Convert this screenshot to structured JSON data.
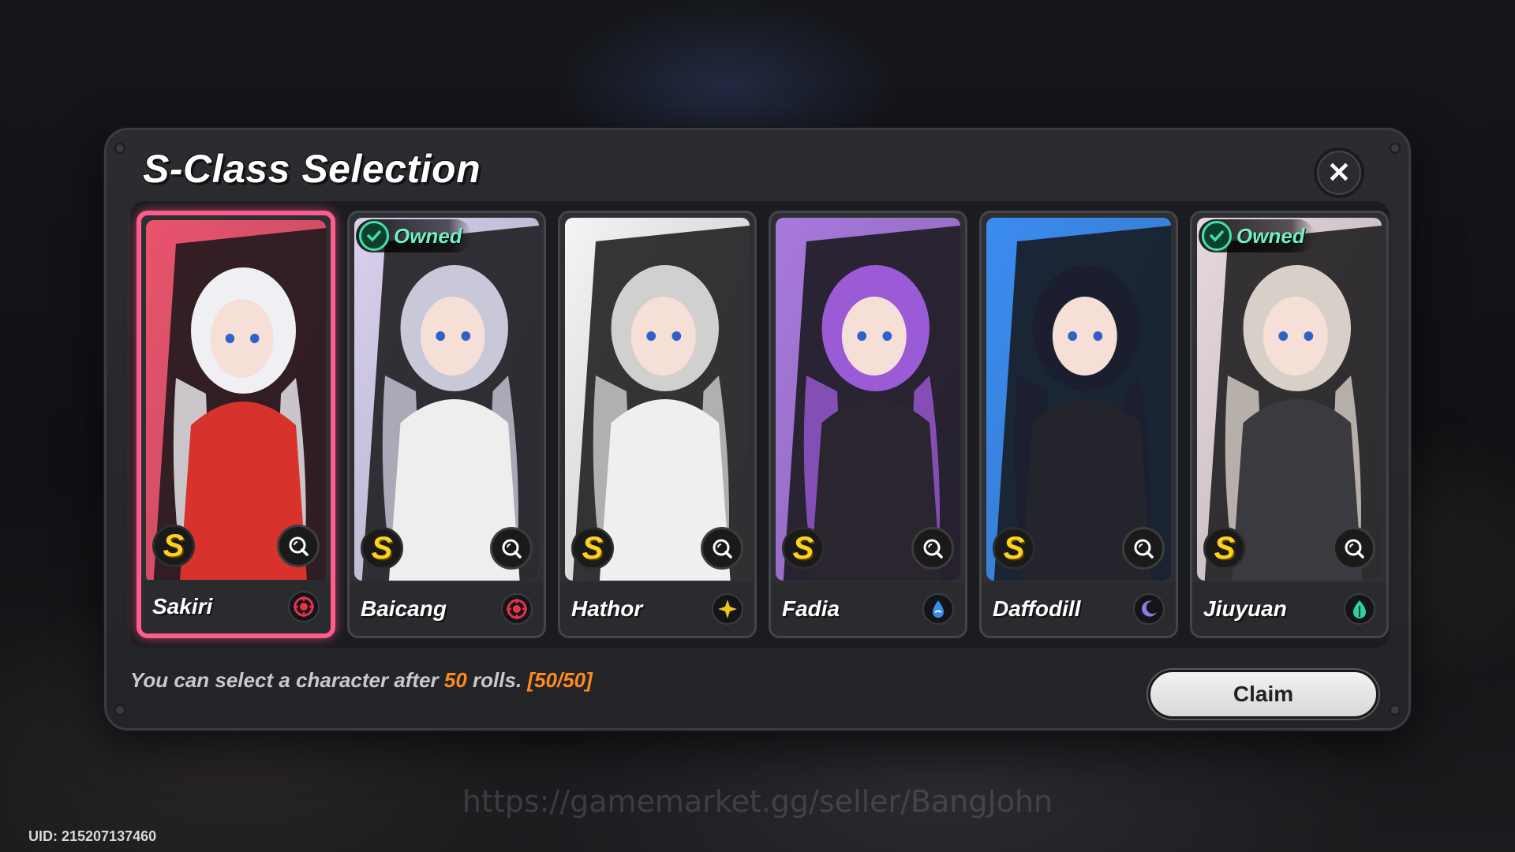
{
  "dialog": {
    "title": "S-Class Selection",
    "close_icon": "close-icon",
    "footer": {
      "prefix": "You can select a character after ",
      "rolls": "50",
      "middle": " rolls. ",
      "progress": "[50/50]"
    },
    "claim_label": "Claim"
  },
  "cards": [
    {
      "name": "Sakiri",
      "owned": false,
      "selected": true,
      "rank": "S",
      "attribute_icon": "target-icon",
      "accent": "#ff5c8c",
      "bg": "#e9536d",
      "hair": "#f0f0f4",
      "outfit": "#d8322c",
      "attr_color": "#e8324a"
    },
    {
      "name": "Baicang",
      "owned": true,
      "selected": false,
      "rank": "S",
      "attribute_icon": "target-icon",
      "accent": "#c9bde6",
      "bg": "#d8d0ee",
      "hair": "#c8c8d8",
      "outfit": "#eeeeee",
      "attr_color": "#e8324a"
    },
    {
      "name": "Hathor",
      "owned": false,
      "selected": false,
      "rank": "S",
      "attribute_icon": "star-icon",
      "accent": "#f2f2f2",
      "bg": "#f4f4f4",
      "hair": "#d0d0d0",
      "outfit": "#efefef",
      "attr_color": "#f2c21e"
    },
    {
      "name": "Fadia",
      "owned": false,
      "selected": false,
      "rank": "S",
      "attribute_icon": "water-icon",
      "accent": "#a87be0",
      "bg": "#a779dc",
      "hair": "#9b5ad6",
      "outfit": "#2b2530",
      "attr_color": "#3a8ee8"
    },
    {
      "name": "Daffodill",
      "owned": false,
      "selected": false,
      "rank": "S",
      "attribute_icon": "moon-icon",
      "accent": "#3c8ef0",
      "bg": "#3a8cf0",
      "hair": "#1b1e2e",
      "outfit": "#24252c",
      "attr_color": "#8a7be6"
    },
    {
      "name": "Jiuyuan",
      "owned": true,
      "selected": false,
      "rank": "S",
      "attribute_icon": "leaf-icon",
      "accent": "#e0d0d8",
      "bg": "#e6d8de",
      "hair": "#d8d0c8",
      "outfit": "#3a3a40",
      "attr_color": "#2fd09a"
    }
  ],
  "owned_label": "Owned",
  "watermark": "https://gamemarket.gg/seller/BangJohn",
  "uid": "UID: 215207137460"
}
